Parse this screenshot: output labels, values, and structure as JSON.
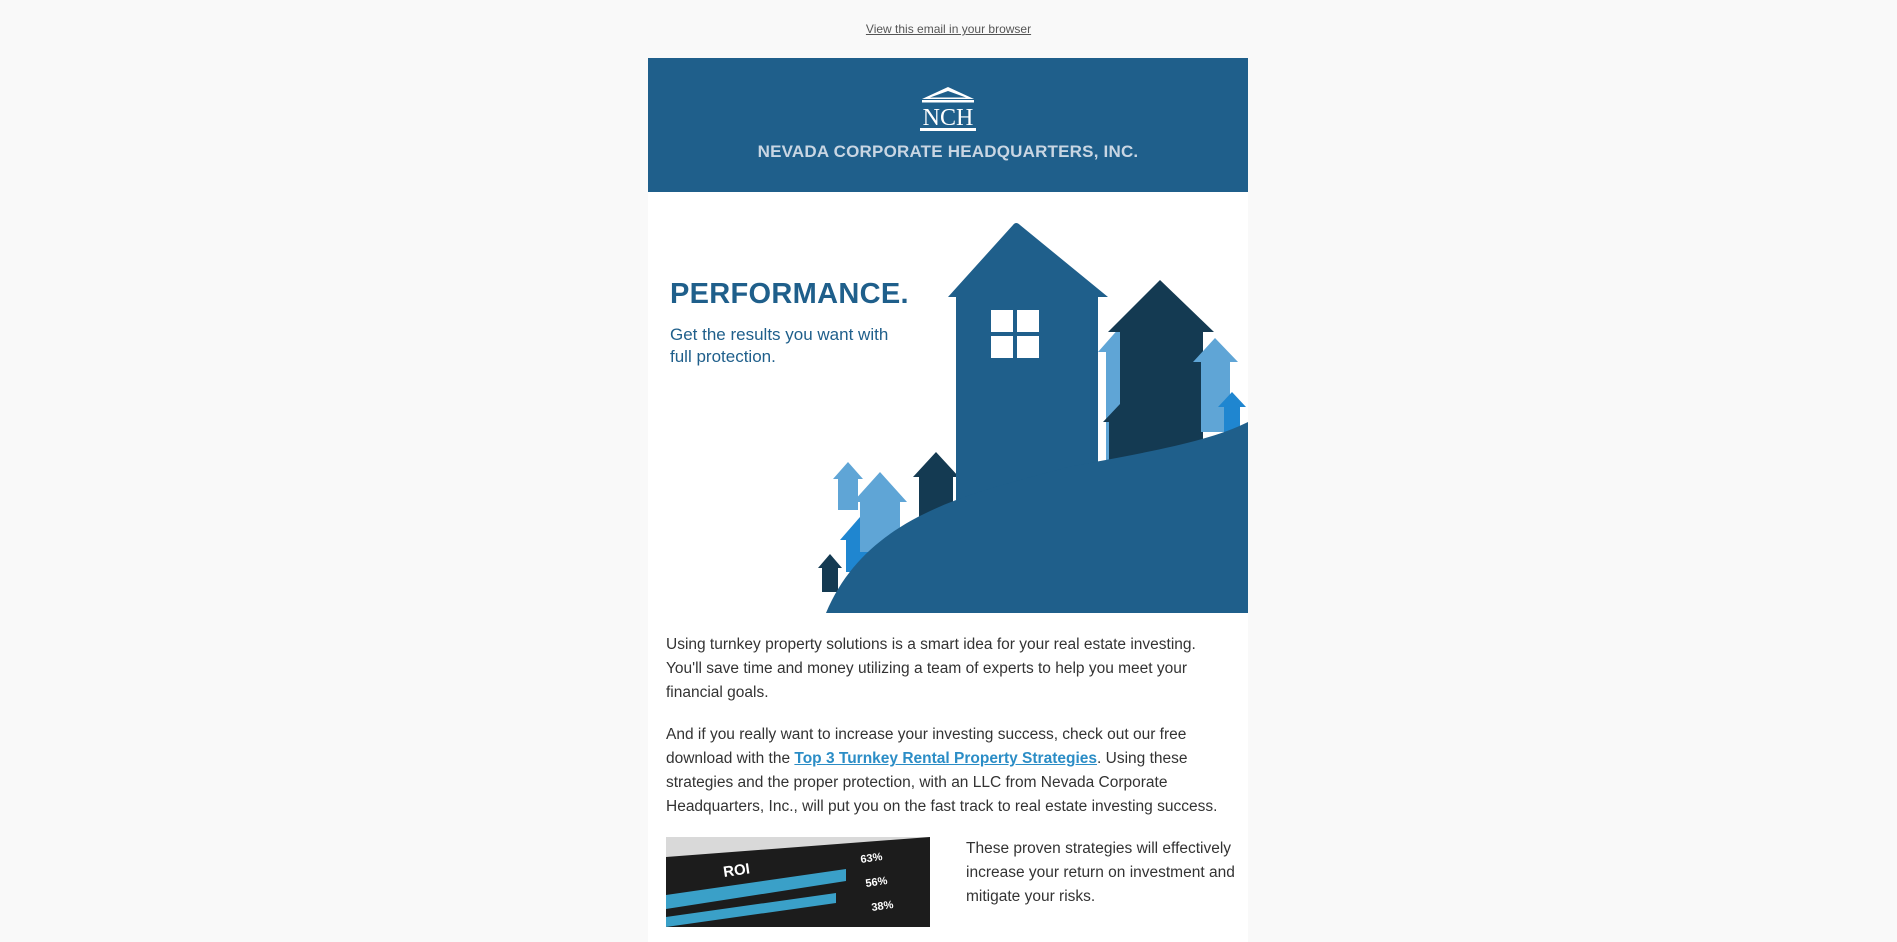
{
  "preheader": {
    "view_in_browser": "View this email in your browser"
  },
  "header": {
    "logo_letters": "NCH",
    "company_name": "NEVADA CORPORATE HEADQUARTERS, INC.",
    "bg_color": "#1f5f8b"
  },
  "hero": {
    "title": "PERFORMANCE.",
    "subtitle": "Get the results you want with full protection."
  },
  "body": {
    "paragraph1": "Using turnkey property solutions is a smart idea for your real estate investing. You'll save time and money utilizing a team of experts to help you meet your financial goals.",
    "paragraph2_before": "And if you really want to increase your investing success, check out our free download with the ",
    "paragraph2_link": "Top 3 Turnkey Rental Property Strategies",
    "paragraph2_after": ".  Using these strategies and the proper protection, with an LLC from Nevada Corporate Headquarters, Inc., will put you on the fast track to real estate investing success.",
    "link_color": "#2b8dc6"
  },
  "roi_image": {
    "label": "ROI",
    "values": [
      "63%",
      "56%",
      "38%"
    ]
  },
  "roi_text": "These proven strategies will effectively increase your return on investment and mitigate your risks."
}
